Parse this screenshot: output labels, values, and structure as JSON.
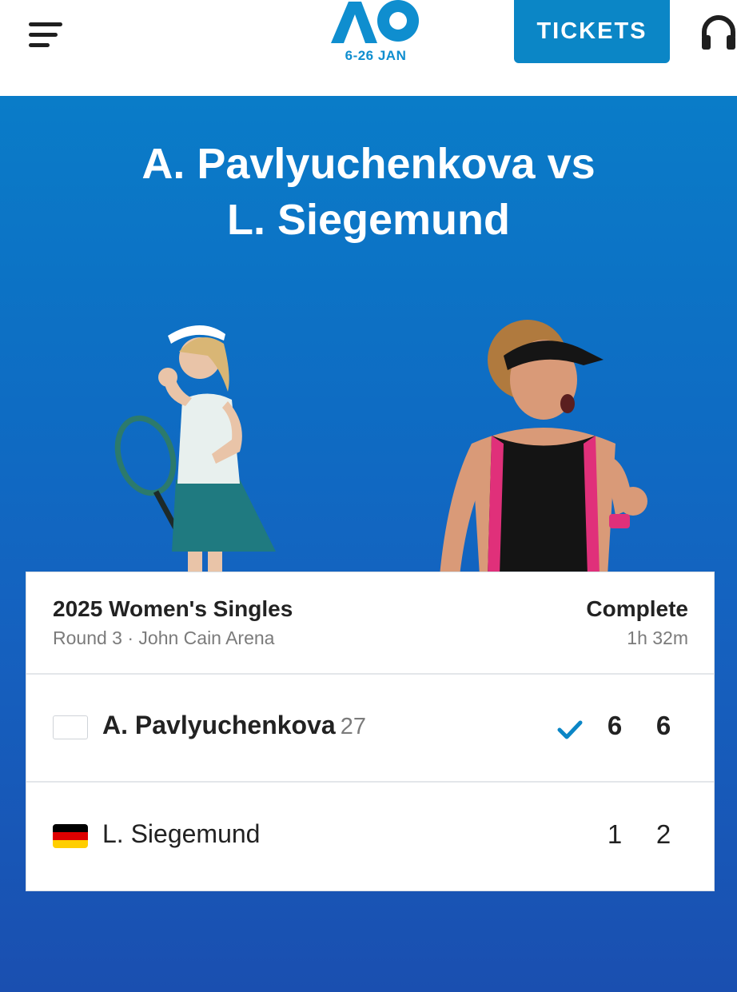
{
  "header": {
    "logo_dates": "6-26 JAN",
    "tickets_label": "TICKETS"
  },
  "colors": {
    "brand": "#0b86c6",
    "hero_top": "#0a7cc8",
    "hero_bottom": "#1a4fb0",
    "check": "#0b86c6"
  },
  "icons": {
    "menu": "hamburger-menu-icon",
    "support": "headset-icon",
    "winner": "check-icon"
  },
  "match": {
    "title_line1": "A. Pavlyuchenkova vs",
    "title_line2": "L. Siegemund",
    "event": "2025 Women's Singles",
    "round_venue": "Round 3 · John Cain Arena",
    "status": "Complete",
    "duration": "1h 32m",
    "players": [
      {
        "name": "A. Pavlyuchenkova",
        "seed": "27",
        "flag": "blank",
        "winner": true,
        "sets": [
          "6",
          "6"
        ]
      },
      {
        "name": "L. Siegemund",
        "seed": "",
        "flag": "germany",
        "winner": false,
        "sets": [
          "1",
          "2"
        ]
      }
    ]
  }
}
